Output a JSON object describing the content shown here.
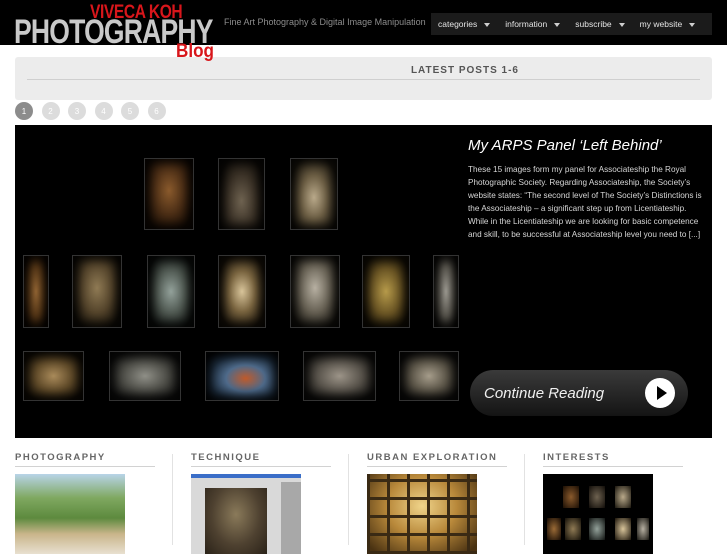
{
  "header": {
    "logo_name": "VIVECA KOH",
    "logo_main": "PHOTOGRAPHY",
    "logo_blog": "Blog",
    "tagline": "Fine Art Photography & Digital Image Manipulation"
  },
  "nav": {
    "items": [
      {
        "label": "categories"
      },
      {
        "label": "information"
      },
      {
        "label": "subscribe"
      },
      {
        "label": "my website"
      }
    ]
  },
  "latest": {
    "title": "LATEST POSTS 1-6"
  },
  "pager": {
    "pages": [
      "1",
      "2",
      "3",
      "4",
      "5",
      "6"
    ],
    "active": "1"
  },
  "feature": {
    "title": "My ARPS Panel ‘Left Behind’",
    "excerpt": "These 15 images form my panel for Associateship the Royal Photographic Society.  Regarding Associateship, the Society’s website states:  “The second level of The Society’s Distinctions is the Associateship – a significant step up from Licentiateship. While in the Licentiateship  we are looking for basic competence and skill, to be successful at Associateship level you need to [...]",
    "continue_label": "Continue Reading"
  },
  "categories": [
    {
      "label": "PHOTOGRAPHY"
    },
    {
      "label": "TECHNIQUE"
    },
    {
      "label": "URBAN EXPLORATION"
    },
    {
      "label": "INTERESTS"
    }
  ],
  "colors": {
    "brand_red": "#d8161b",
    "header_bg": "#000000",
    "nav_bg": "#1b1b1b",
    "bar_bg": "#ececec"
  }
}
